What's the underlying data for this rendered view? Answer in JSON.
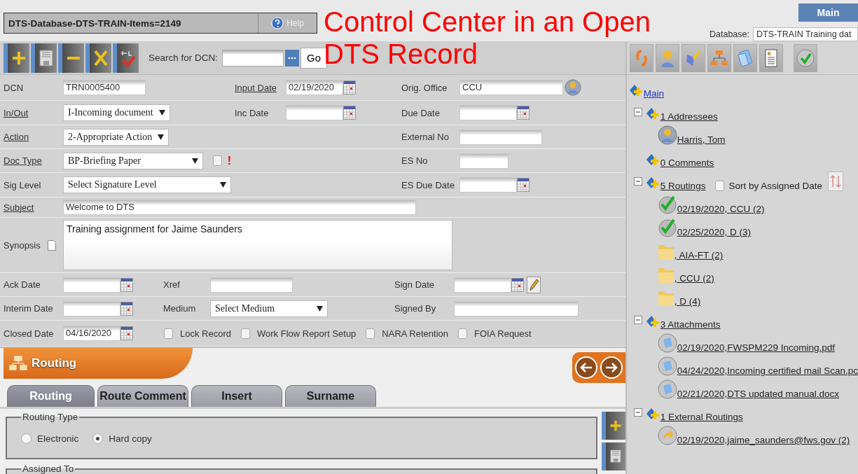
{
  "header": {
    "title": "DTS-Database-DTS-TRAIN-Items=2149",
    "help": "Help"
  },
  "annotation": [
    "Control Center in an Open",
    "DTS Record"
  ],
  "top_right": {
    "main_button": "Main",
    "database_label": "Database:",
    "database_value": "DTS-TRAIN Training dat"
  },
  "toolbar": {
    "search_label": "Search for DCN:",
    "go": "Go"
  },
  "form": {
    "fields": [
      {
        "label": "DCN",
        "link": false,
        "kind": "text",
        "value": "TRN0005400"
      },
      {
        "label": "Input Date",
        "link": true,
        "kind": "date",
        "value": "02/19/2020"
      },
      {
        "label": "Orig. Office",
        "link": false,
        "kind": "person",
        "value": "CCU"
      },
      {
        "label": "In/Out",
        "link": true,
        "kind": "select",
        "value": "I-Incoming document"
      },
      {
        "label": "Inc Date",
        "link": false,
        "kind": "date"
      },
      {
        "label": "Due Date",
        "link": false,
        "kind": "date"
      },
      {
        "label": "Action",
        "link": true,
        "kind": "select",
        "value": "2-Appropriate Action"
      },
      {
        "label": "External No",
        "link": false,
        "kind": "text"
      },
      {
        "label": "Doc Type",
        "link": true,
        "kind": "select",
        "value": "BP-Briefing Paper",
        "checked": false,
        "flag": "!"
      },
      {
        "label": "ES No",
        "link": false,
        "kind": "text"
      },
      {
        "label": "Sig Level",
        "link": false,
        "kind": "select",
        "value": "Select Signature Level"
      },
      {
        "label": "ES Due Date",
        "link": false,
        "kind": "date"
      },
      {
        "label": "Subject",
        "link": true,
        "kind": "text",
        "value": "Welcome to DTS"
      },
      {
        "label": "Synopsis",
        "link": false,
        "kind": "textarea",
        "value": "Training assignment for Jaime Saunders"
      },
      {
        "label": "Ack Date",
        "link": false,
        "kind": "date"
      },
      {
        "label": "Xref",
        "link": false,
        "kind": "text"
      },
      {
        "label": "Sign Date",
        "link": false,
        "kind": "date"
      },
      {
        "label": "Interim Date",
        "link": false,
        "kind": "date"
      },
      {
        "label": "Medium",
        "link": false,
        "kind": "select",
        "value": "Select Medium"
      },
      {
        "label": "Signed By",
        "link": false,
        "kind": "text"
      },
      {
        "label": "Closed Date",
        "link": false,
        "kind": "date",
        "value": "04/16/2020"
      }
    ],
    "options": [
      {
        "label": "Lock Record",
        "checked": false
      },
      {
        "label": "Work Flow Report Setup",
        "checked": false
      },
      {
        "label": "NARA Retention",
        "checked": false
      },
      {
        "label": "FOIA Request",
        "checked": false
      }
    ]
  },
  "routing": {
    "title": "Routing",
    "tabs": [
      {
        "label": "Routing",
        "selected": true
      },
      {
        "label": "Route Comment",
        "selected": false
      },
      {
        "label": "Insert",
        "selected": false
      },
      {
        "label": "Surname",
        "selected": false
      }
    ],
    "routing_type": {
      "legend": "Routing Type",
      "options": [
        {
          "label": "Electronic",
          "selected": false
        },
        {
          "label": "Hard copy",
          "selected": true
        }
      ]
    },
    "assigned_legend": "Assigned To"
  },
  "tree": {
    "root": {
      "label": "Main",
      "kind": "group",
      "children": [
        {
          "label": "1 Addressees",
          "kind": "group",
          "expanded": true,
          "children": [
            {
              "label": "Harris, Tom",
              "kind": "person"
            }
          ]
        },
        {
          "label": "0 Comments",
          "kind": "group"
        },
        {
          "label": "5 Routings",
          "kind": "group",
          "expanded": true,
          "sort": {
            "label": "Sort by Assigned Date",
            "checked": false
          },
          "children": [
            {
              "label": "02/19/2020, CCU (2)",
              "kind": "done"
            },
            {
              "label": "02/25/2020, D (3)",
              "kind": "done"
            },
            {
              "label": ", AIA-FT (2)",
              "kind": "folder"
            },
            {
              "label": ", CCU (2)",
              "kind": "folder"
            },
            {
              "label": ", D (4)",
              "kind": "folder"
            }
          ]
        },
        {
          "label": "3 Attachments",
          "kind": "group",
          "expanded": true,
          "children": [
            {
              "label": "02/19/2020,FWSPM229 Incoming.pdf",
              "kind": "attachment"
            },
            {
              "label": "04/24/2020,Incoming certified mail Scan.pc",
              "kind": "attachment"
            },
            {
              "label": "02/21/2020,DTS updated manual.docx",
              "kind": "attachment"
            }
          ]
        },
        {
          "label": "1 External Routings",
          "kind": "group",
          "expanded": true,
          "children": [
            {
              "label": "02/19/2020,jaime_saunders@fws.gov (2)",
              "kind": "external"
            }
          ]
        }
      ]
    }
  }
}
